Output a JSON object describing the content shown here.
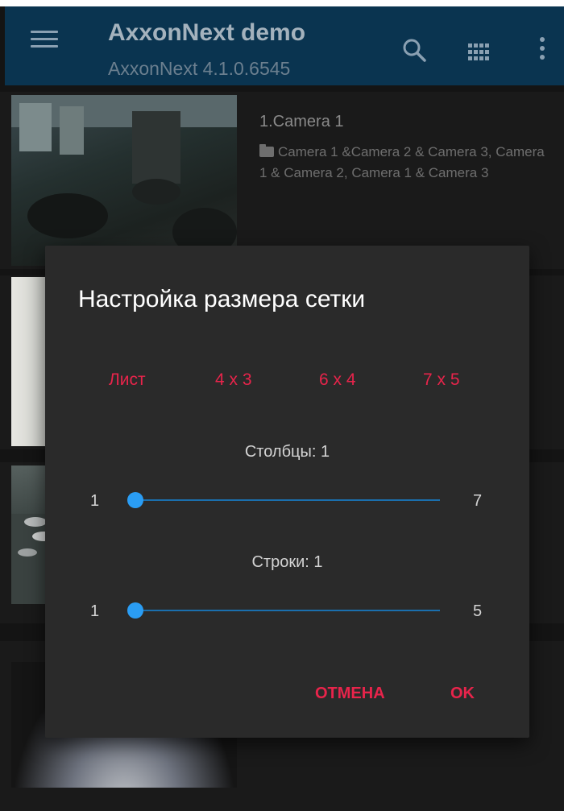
{
  "app_bar": {
    "title": "AxxonNext demo",
    "subtitle": "AxxonNext 4.1.0.6545",
    "menu_icon": "hamburger-menu-icon",
    "search_icon": "search-icon",
    "grid_icon": "grid-layout-icon",
    "more_icon": "overflow-menu-icon"
  },
  "cameras": [
    {
      "name": "1.Camera 1",
      "folder_text": "Camera 1 &Camera 2 & Camera 3, Camera 1 & Camera 2, Camera 1 & Camera 3"
    }
  ],
  "dialog": {
    "title": "Настройка размера сетки",
    "presets": [
      "Лист",
      "4 x 3",
      "6 x 4",
      "7 x 5"
    ],
    "columns": {
      "caption": "Столбцы: 1",
      "min": "1",
      "max": "7",
      "value": 1
    },
    "rows": {
      "caption": "Строки: 1",
      "min": "1",
      "max": "5",
      "value": 1
    },
    "cancel_label": "ОТМЕНА",
    "ok_label": "OK"
  },
  "colors": {
    "app_bar": "#0a3450",
    "accent": "#e8244b",
    "slider": "#2a9df4",
    "dialog_bg": "#2a2a2a"
  }
}
